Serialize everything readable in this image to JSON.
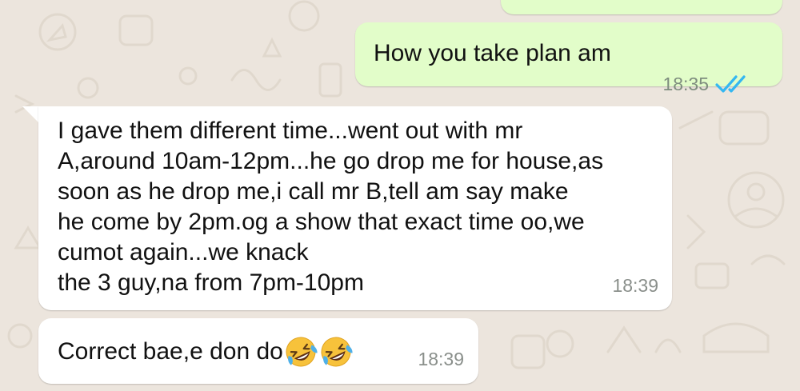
{
  "chat": {
    "messages": [
      {
        "direction": "outgoing",
        "text": "",
        "time": ""
      },
      {
        "direction": "outgoing",
        "text": "How you take plan am",
        "time": "18:35",
        "status_icon": "double-check-read-icon",
        "status_color": "#34b7f1"
      },
      {
        "direction": "incoming",
        "lines": [
          "I gave them different time...went out with mr",
          "A,around 10am-12pm...he go drop me for house,as",
          "soon as he drop me,i call mr B,tell am say make",
          "he come by 2pm.og a show that exact time oo,we",
          "cumot again...we knack",
          "the 3 guy,na from 7pm-10pm"
        ],
        "time": "18:39"
      },
      {
        "direction": "incoming",
        "text": "Correct bae,e don do",
        "emojis": [
          "rolling-on-floor-laughing-emoji",
          "rolling-on-floor-laughing-emoji"
        ],
        "time": "18:39"
      }
    ]
  },
  "colors": {
    "background": "#ece5dd",
    "outgoing_bubble": "#e2fdc9",
    "incoming_bubble": "#ffffff",
    "timestamp": "#8a8f8b",
    "read_ticks": "#34b7f1"
  }
}
